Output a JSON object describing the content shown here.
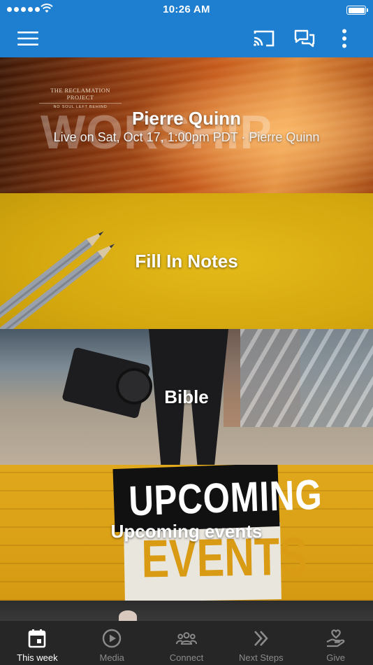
{
  "status_bar": {
    "time": "10:26 AM"
  },
  "app_bar": {
    "menu_icon": "hamburger-menu-icon",
    "cast_icon": "cast-icon",
    "chat_icon": "chat-icon",
    "more_icon": "more-vertical-icon"
  },
  "feed": {
    "tiles": [
      {
        "title": "Pierre Quinn",
        "subtitle": "Live on Sat, Oct 17, 1:00pm PDT · Pierre Quinn",
        "image_text": "WORSHIP",
        "brand_line1": "THE RECLAMATION PROJECT",
        "brand_line2": "NO SOUL LEFT BEHIND"
      },
      {
        "title": "Fill In Notes"
      },
      {
        "title": "Bible"
      },
      {
        "title": "Upcoming events",
        "image_text_top": "UPCOMING",
        "image_text_bottom": "EVENTS"
      }
    ]
  },
  "tab_bar": {
    "active": "This week",
    "tabs": [
      {
        "label": "This week",
        "icon": "calendar-icon"
      },
      {
        "label": "Media",
        "icon": "play-circle-icon"
      },
      {
        "label": "Connect",
        "icon": "group-icon"
      },
      {
        "label": "Next Steps",
        "icon": "double-chevron-right-icon"
      },
      {
        "label": "Give",
        "icon": "hand-heart-icon"
      }
    ]
  },
  "colors": {
    "primary": "#1e7fd0",
    "tab_bar_bg": "#262626",
    "tab_inactive": "#8b8b8b",
    "tab_active": "#ffffff"
  }
}
